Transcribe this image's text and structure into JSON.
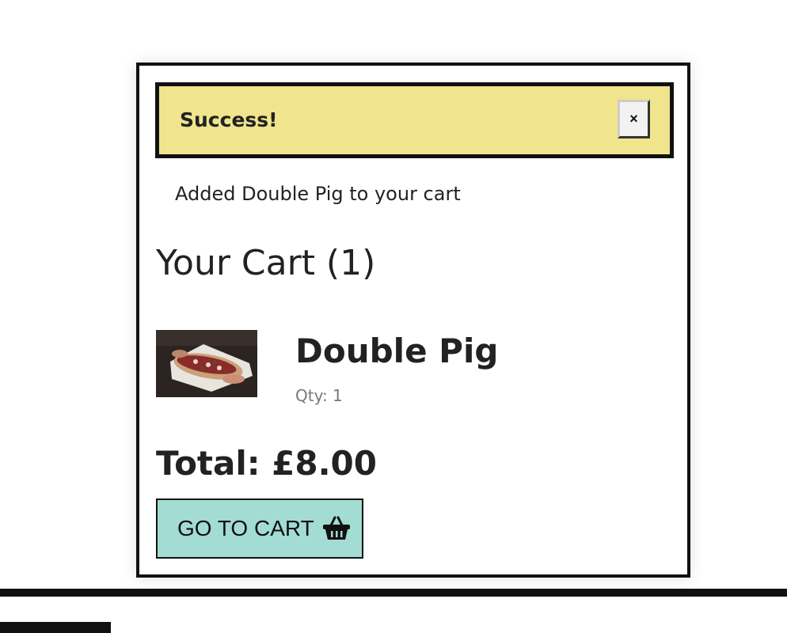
{
  "alert": {
    "title": "Success!",
    "close_label": "×",
    "message": "Added Double Pig to your cart"
  },
  "cart": {
    "heading": "Your Cart (1)",
    "items": [
      {
        "name": "Double Pig",
        "qty_label": "Qty: 1"
      }
    ],
    "total_label": "Total: £8.00",
    "go_to_cart_label": "GO TO CART"
  },
  "colors": {
    "alert_background": "#f0e48d",
    "button_background": "#a3dcd3",
    "border": "#111111"
  },
  "icons": {
    "close": "close-icon",
    "basket": "basket-icon"
  }
}
